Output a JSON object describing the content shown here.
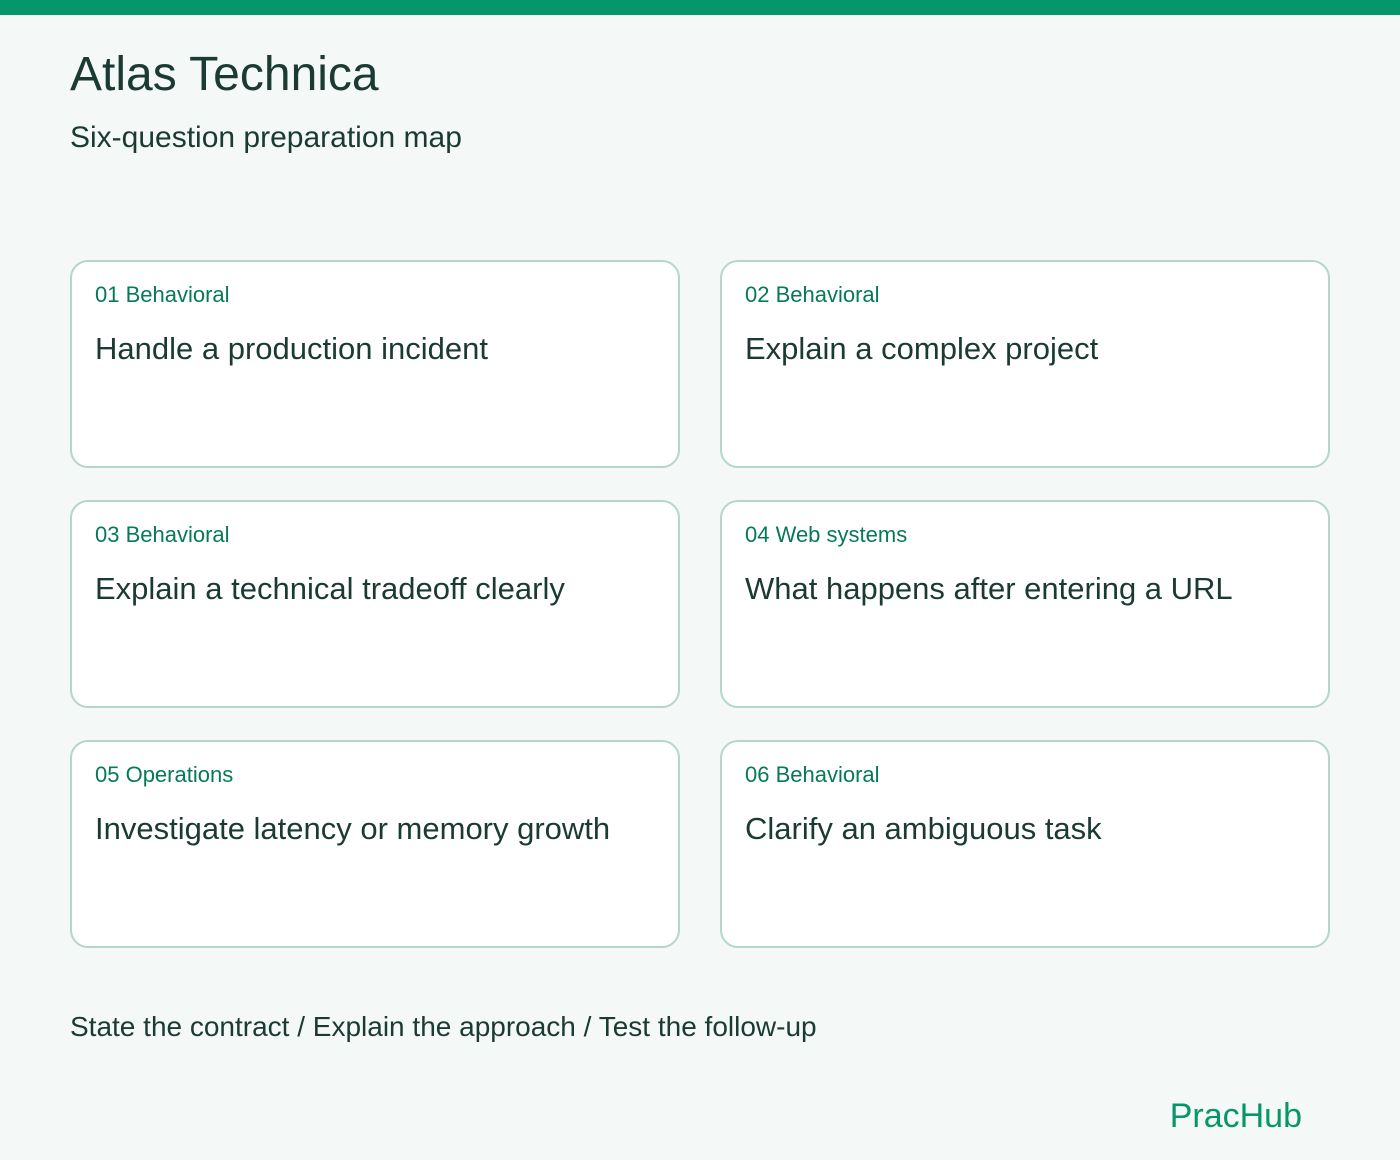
{
  "header": {
    "title": "Atlas Technica",
    "subtitle": "Six-question preparation map"
  },
  "cards": [
    {
      "tag": "01 Behavioral",
      "title": "Handle a production incident"
    },
    {
      "tag": "02 Behavioral",
      "title": "Explain a complex project"
    },
    {
      "tag": "03 Behavioral",
      "title": "Explain a technical tradeoff clearly"
    },
    {
      "tag": "04 Web systems",
      "title": "What happens after entering a URL"
    },
    {
      "tag": "05 Operations",
      "title": "Investigate latency or memory growth"
    },
    {
      "tag": "06 Behavioral",
      "title": "Clarify an ambiguous task"
    }
  ],
  "footer": {
    "steps": "State the contract / Explain the approach / Test the follow-up",
    "brand": "PracHub"
  },
  "colors": {
    "accent": "#05966b",
    "tag_text": "#067a57",
    "card_border": "#b5d6cb",
    "background": "#f4f8f6",
    "text": "#1b3a33"
  }
}
